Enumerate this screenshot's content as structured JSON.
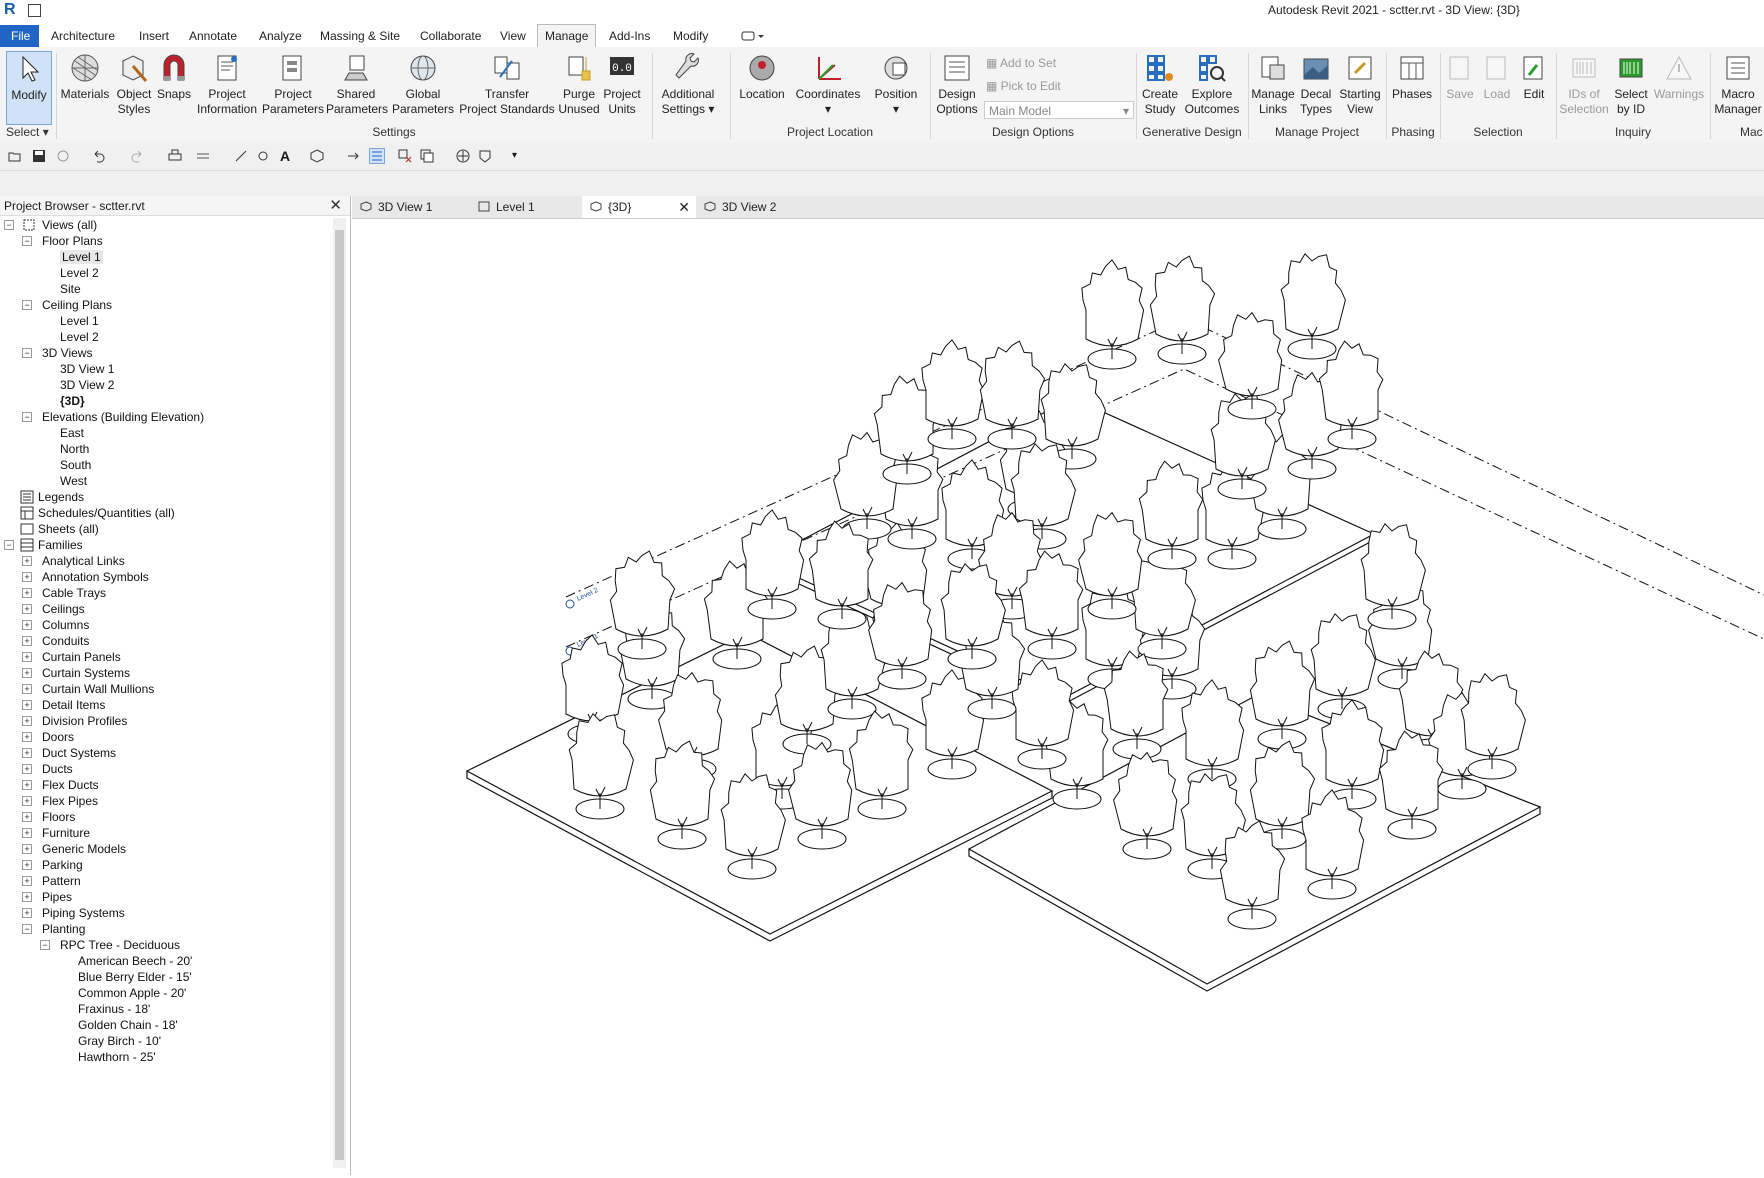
{
  "app": {
    "title": "Autodesk Revit 2021 - sctter.rvt - 3D View: {3D}",
    "logo": "R"
  },
  "menu_tabs": [
    "File",
    "Architecture",
    "Insert",
    "Annotate",
    "Analyze",
    "Massing & Site",
    "Collaborate",
    "View",
    "Manage",
    "Add-Ins",
    "Modify"
  ],
  "ribbon": {
    "modify": "Modify",
    "select_label": "Select",
    "settings": {
      "label": "Settings",
      "buttons": [
        {
          "l1": "Materials",
          "l2": ""
        },
        {
          "l1": "Object",
          "l2": "Styles"
        },
        {
          "l1": "Snaps",
          "l2": ""
        },
        {
          "l1": "Project",
          "l2": "Information"
        },
        {
          "l1": "Project",
          "l2": "Parameters"
        },
        {
          "l1": "Shared",
          "l2": "Parameters"
        },
        {
          "l1": "Global",
          "l2": "Parameters"
        },
        {
          "l1": "Transfer",
          "l2": "Project Standards"
        },
        {
          "l1": "Purge",
          "l2": "Unused"
        },
        {
          "l1": "Project",
          "l2": "Units"
        },
        {
          "l1": "Additional",
          "l2": "Settings"
        }
      ]
    },
    "project_location": {
      "label": "Project Location",
      "buttons": [
        {
          "l1": "Location",
          "l2": ""
        },
        {
          "l1": "Coordinates",
          "l2": ""
        },
        {
          "l1": "Position",
          "l2": ""
        }
      ]
    },
    "design_options": {
      "label": "Design Options",
      "button": {
        "l1": "Design",
        "l2": "Options"
      },
      "add_to_set": "Add to Set",
      "pick_to_edit": "Pick to Edit",
      "main_model": "Main Model"
    },
    "generative_design": {
      "label": "Generative Design",
      "buttons": [
        {
          "l1": "Create",
          "l2": "Study"
        },
        {
          "l1": "Explore",
          "l2": "Outcomes"
        }
      ]
    },
    "manage_project": {
      "label": "Manage Project",
      "buttons": [
        {
          "l1": "Manage",
          "l2": "Links"
        },
        {
          "l1": "Decal",
          "l2": "Types"
        },
        {
          "l1": "Starting",
          "l2": "View"
        }
      ]
    },
    "phasing": {
      "label": "Phasing",
      "buttons": [
        {
          "l1": "Phases",
          "l2": ""
        }
      ]
    },
    "selection": {
      "label": "Selection",
      "buttons": [
        {
          "l1": "Save",
          "l2": ""
        },
        {
          "l1": "Load",
          "l2": ""
        },
        {
          "l1": "Edit",
          "l2": ""
        }
      ]
    },
    "inquiry": {
      "label": "Inquiry",
      "buttons": [
        {
          "l1": "IDs of",
          "l2": "Selection"
        },
        {
          "l1": "Select",
          "l2": "by ID"
        },
        {
          "l1": "Warnings",
          "l2": ""
        }
      ]
    },
    "macros": {
      "label": "Mac",
      "buttons": [
        {
          "l1": "Macro",
          "l2": "Manager"
        }
      ]
    }
  },
  "project_browser": {
    "title": "Project Browser - sctter.rvt",
    "tree": {
      "views_all": "Views (all)",
      "floor_plans": "Floor Plans",
      "fp_level1": "Level 1",
      "fp_level2": "Level 2",
      "fp_site": "Site",
      "ceiling_plans": "Ceiling Plans",
      "cp_level1": "Level 1",
      "cp_level2": "Level 2",
      "views_3d": "3D Views",
      "v3d1": "3D View 1",
      "v3d2": "3D View 2",
      "v3d": "{3D}",
      "elevations": "Elevations (Building Elevation)",
      "east": "East",
      "north": "North",
      "south": "South",
      "west": "West",
      "legends": "Legends",
      "schedules": "Schedules/Quantities (all)",
      "sheets": "Sheets (all)",
      "families": "Families",
      "family_cats": [
        "Analytical Links",
        "Annotation Symbols",
        "Cable Trays",
        "Ceilings",
        "Columns",
        "Conduits",
        "Curtain Panels",
        "Curtain Systems",
        "Curtain Wall Mullions",
        "Detail Items",
        "Division Profiles",
        "Doors",
        "Duct Systems",
        "Ducts",
        "Flex Ducts",
        "Flex Pipes",
        "Floors",
        "Furniture",
        "Generic Models",
        "Parking",
        "Pattern",
        "Pipes",
        "Piping Systems"
      ],
      "planting": "Planting",
      "rpc": "RPC Tree - Deciduous",
      "trees": [
        "American Beech - 20'",
        "Blue Berry Elder - 15'",
        "Common Apple - 20'",
        "Fraxinus - 18'",
        "Golden Chain - 18'",
        "Gray Birch - 10'",
        "Hawthorn - 25'"
      ]
    }
  },
  "view_tabs": [
    {
      "label": "3D View 1"
    },
    {
      "label": "Level 1"
    },
    {
      "label": "{3D}"
    },
    {
      "label": "3D View 2"
    }
  ],
  "canvas": {
    "level2": "Level 2",
    "level1": "Level 1"
  },
  "colors": {
    "accent": "#1f66c4",
    "ribbon_bg": "#f4f4f4",
    "selected": "#cfe2f7"
  }
}
